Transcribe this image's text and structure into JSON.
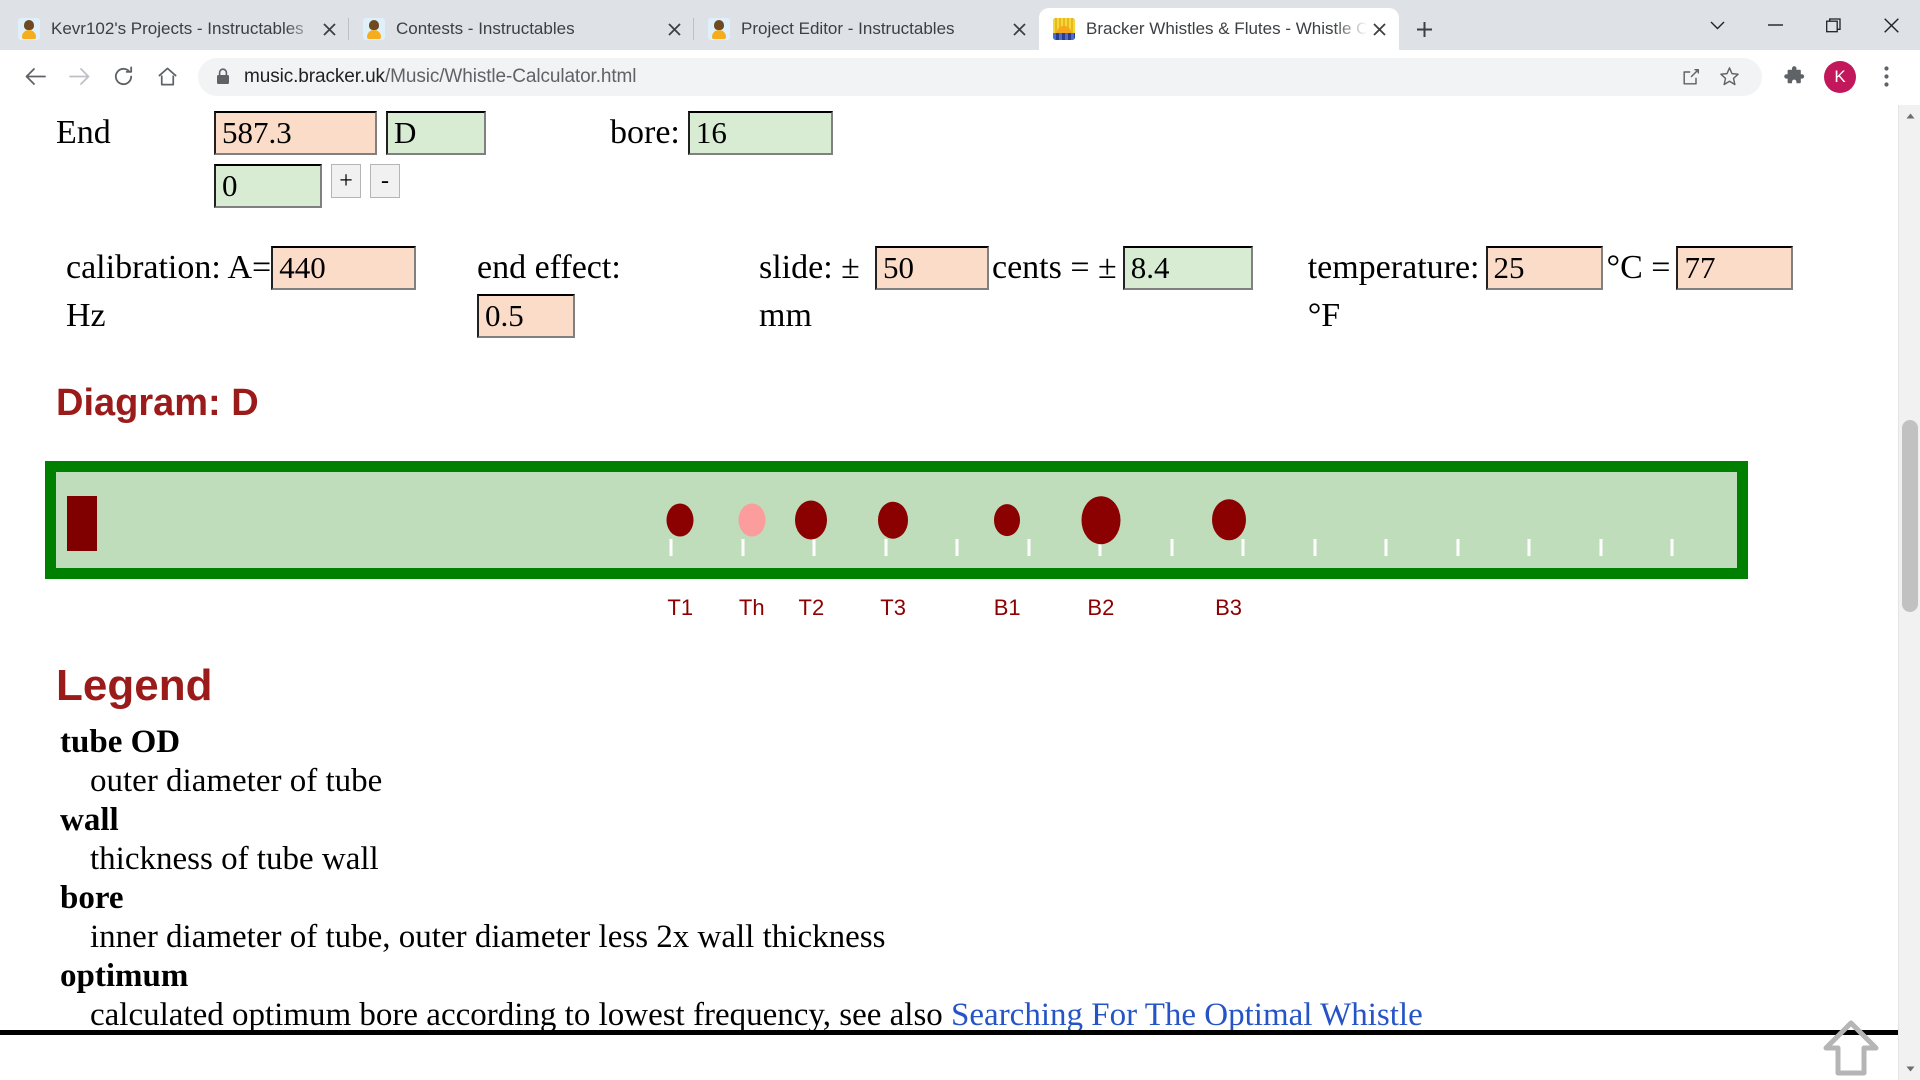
{
  "browser": {
    "tabs": [
      {
        "title": "Kevr102's Projects - Instructables",
        "favicon": "instructables-icon",
        "active": false
      },
      {
        "title": "Contests - Instructables",
        "favicon": "instructables-icon",
        "active": false
      },
      {
        "title": "Project Editor - Instructables",
        "favicon": "instructables-icon",
        "active": false
      },
      {
        "title": "Bracker Whistles & Flutes - Whistle Calculator",
        "favicon": "bracker-icon",
        "active": true
      }
    ],
    "new_tab_label": "+",
    "window_controls": {
      "minimize": "—",
      "maximize": "❐",
      "close": "✕",
      "list_tabs": "⌄"
    },
    "nav": {
      "back": "back-arrow-icon",
      "forward": "forward-arrow-icon",
      "reload": "reload-icon",
      "home": "home-icon"
    },
    "omnibox": {
      "lock": "lock-icon",
      "url_host": "music.bracker.uk",
      "url_path": "/Music/Whistle-Calculator.html",
      "share": "share-icon",
      "bookmark": "star-icon"
    },
    "toolbar": {
      "extensions": "puzzle-icon",
      "profile_initial": "K",
      "profile_color": "#c2185b",
      "menu": "three-dot-menu-icon"
    }
  },
  "page": {
    "end_row": {
      "label": "End",
      "frequency_value": "587.3",
      "note_value": "D",
      "octave_value": "0",
      "increment_label": "+",
      "decrement_label": "-",
      "bore_label": "bore:",
      "bore_value": "16"
    },
    "params_row": {
      "calibration_label": "calibration: A=",
      "calibration_value": "440",
      "calibration_unit": "Hz",
      "end_effect_label": "end effect:",
      "end_effect_value": "0.5",
      "slide_label": "slide: ±",
      "slide_value": "50",
      "slide_unit": "mm",
      "cents_label": "cents = ±",
      "cents_value": "8.4",
      "temperature_label": "temperature:",
      "temperature_c_value": "25",
      "temperature_unit_c": "°C =",
      "temperature_f_value": "77",
      "temperature_unit_f": "°F"
    },
    "diagram": {
      "heading": "Diagram: D",
      "colors": {
        "tube_border": "#008000",
        "tube_fill": "#bfdcbb",
        "hole": "#8b0000",
        "thumb_hole": "#fb9d9d",
        "fipple": "#800000",
        "label": "#8b0000"
      },
      "holes": [
        {
          "label": "T1",
          "x_pct": 37.3,
          "diameter": 27,
          "thumb": false
        },
        {
          "label": "Th",
          "x_pct": 41.5,
          "diameter": 27,
          "thumb": true
        },
        {
          "label": "T2",
          "x_pct": 45.0,
          "diameter": 32,
          "thumb": false
        },
        {
          "label": "T3",
          "x_pct": 49.8,
          "diameter": 30,
          "thumb": false
        },
        {
          "label": "B1",
          "x_pct": 56.5,
          "diameter": 26,
          "thumb": false
        },
        {
          "label": "B2",
          "x_pct": 62.0,
          "diameter": 39,
          "thumb": false
        },
        {
          "label": "B3",
          "x_pct": 69.5,
          "diameter": 34,
          "thumb": false
        }
      ],
      "tick_count": 15
    },
    "legend": {
      "heading": "Legend",
      "entries": [
        {
          "term": "tube OD",
          "definition": "outer diameter of tube"
        },
        {
          "term": "wall",
          "definition": "thickness of tube wall"
        },
        {
          "term": "bore",
          "definition": "inner diameter of tube, outer diameter less 2x wall thickness"
        },
        {
          "term": "optimum",
          "definition": "calculated optimum bore according to lowest frequency, see also ",
          "link_text": "Searching For The Optimal Whistle"
        }
      ]
    },
    "back_to_top": "up-arrow-icon"
  }
}
